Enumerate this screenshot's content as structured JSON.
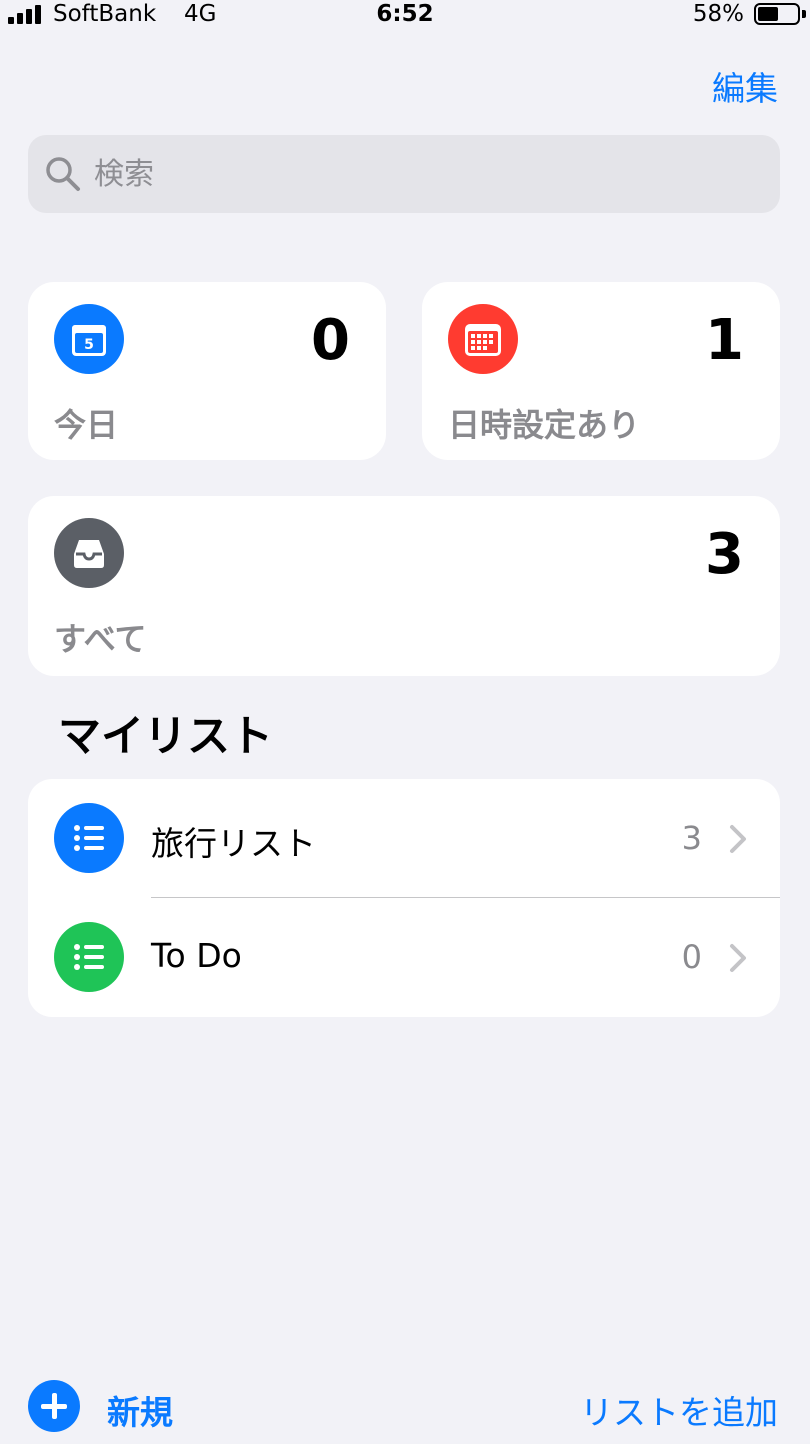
{
  "status_bar": {
    "carrier": "SoftBank",
    "network": "4G",
    "time": "6:52",
    "battery_percent": "58%",
    "battery_level": 0.58
  },
  "header": {
    "edit_label": "編集"
  },
  "search": {
    "placeholder": "検索",
    "value": ""
  },
  "smart_lists": {
    "today": {
      "label": "今日",
      "count": "0",
      "icon": "calendar-day-icon",
      "color": "#0a7aff",
      "day_number": "5"
    },
    "scheduled": {
      "label": "日時設定あり",
      "count": "1",
      "icon": "calendar-grid-icon",
      "color": "#ff3b30"
    },
    "all": {
      "label": "すべて",
      "count": "3",
      "icon": "tray-icon",
      "color": "#5b5f66"
    }
  },
  "my_lists": {
    "title": "マイリスト",
    "items": [
      {
        "name": "旅行リスト",
        "count": "3",
        "icon": "list-bullet-icon",
        "color": "#0a7aff"
      },
      {
        "name": "To Do",
        "count": "0",
        "icon": "list-bullet-icon",
        "color": "#1fc457"
      }
    ]
  },
  "toolbar": {
    "new_label": "新規",
    "new_icon": "plus-circle-icon",
    "add_list_label": "リストを追加"
  },
  "colors": {
    "accent": "#0a7aff",
    "background": "#f2f2f7"
  }
}
